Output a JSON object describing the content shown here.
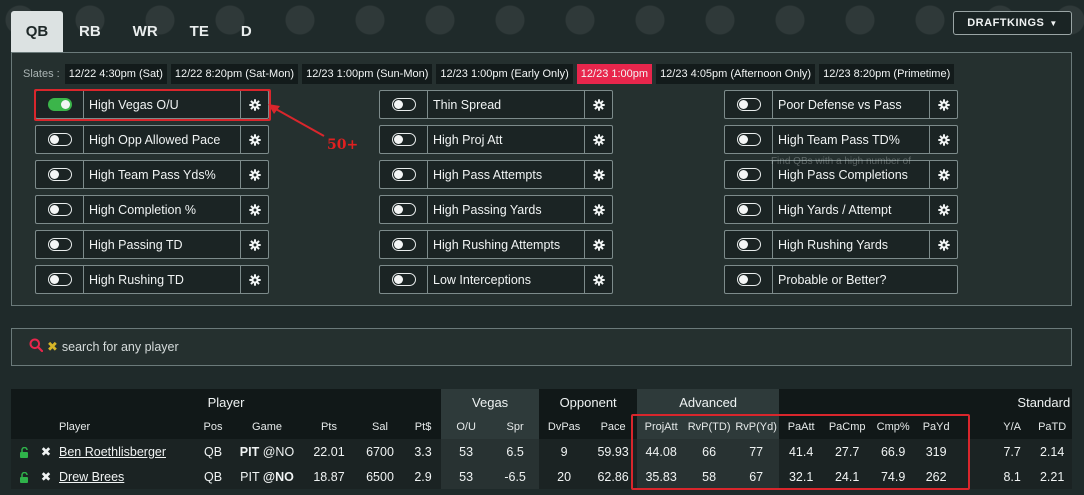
{
  "tabs": [
    "QB",
    "RB",
    "WR",
    "TE",
    "D"
  ],
  "site_button": "DRAFTKINGS",
  "slates_label": "Slates :",
  "slates": [
    {
      "label": "12/22 4:30pm (Sat)",
      "active": false
    },
    {
      "label": "12/22 8:20pm (Sat-Mon)",
      "active": false
    },
    {
      "label": "12/23 1:00pm (Sun-Mon)",
      "active": false
    },
    {
      "label": "12/23 1:00pm (Early Only)",
      "active": false
    },
    {
      "label": "12/23 1:00pm",
      "active": true
    },
    {
      "label": "12/23 4:05pm (Afternoon Only)",
      "active": false
    },
    {
      "label": "12/23 8:20pm (Primetime)",
      "active": false
    }
  ],
  "filters": {
    "col1": [
      {
        "label": "High Vegas O/U",
        "on": true,
        "gear": true
      },
      {
        "label": "High Opp Allowed Pace",
        "on": false,
        "gear": true
      },
      {
        "label": "High Team Pass Yds%",
        "on": false,
        "gear": true
      },
      {
        "label": "High Completion %",
        "on": false,
        "gear": true
      },
      {
        "label": "High Passing TD",
        "on": false,
        "gear": true
      },
      {
        "label": "High Rushing TD",
        "on": false,
        "gear": true
      }
    ],
    "col2": [
      {
        "label": "Thin Spread",
        "on": false,
        "gear": true
      },
      {
        "label": "High Proj Att",
        "on": false,
        "gear": true
      },
      {
        "label": "High Pass Attempts",
        "on": false,
        "gear": true
      },
      {
        "label": "High Passing Yards",
        "on": false,
        "gear": true
      },
      {
        "label": "High Rushing Attempts",
        "on": false,
        "gear": true
      },
      {
        "label": "Low Interceptions",
        "on": false,
        "gear": true
      }
    ],
    "col3": [
      {
        "label": "Poor Defense vs Pass",
        "on": false,
        "gear": true
      },
      {
        "label": "High Team Pass TD%",
        "on": false,
        "gear": true
      },
      {
        "label": "High Pass Completions",
        "on": false,
        "gear": true
      },
      {
        "label": "High Yards / Attempt",
        "on": false,
        "gear": true
      },
      {
        "label": "High Rushing Yards",
        "on": false,
        "gear": true
      },
      {
        "label": "Probable or Better?",
        "on": false,
        "gear": false
      }
    ]
  },
  "tooltip_ghost": "Find QBs with a high number of",
  "annotation": "50+",
  "search": {
    "placeholder": "search for any player"
  },
  "table": {
    "groups": {
      "player": "Player",
      "vegas": "Vegas",
      "opponent": "Opponent",
      "advanced": "Advanced",
      "standard": "Standard"
    },
    "columns": [
      "Player",
      "Pos",
      "Game",
      "Pts",
      "Sal",
      "Pt$",
      "O/U",
      "Spr",
      "DvPas",
      "Pace",
      "ProjAtt",
      "RvP(TD)",
      "RvP(Yd)",
      "PaAtt",
      "PaCmp",
      "Cmp%",
      "PaYd",
      "Y/A",
      "PaTD"
    ],
    "rows": [
      {
        "player": "Ben Roethlisberger",
        "pos": "QB",
        "game_team": "PIT",
        "game_opp": "@NO",
        "team_bold": true,
        "pts": "22.01",
        "sal": "6700",
        "ptd": "3.3",
        "ou": "53",
        "spr": "6.5",
        "dvpas": "9",
        "pace": "59.93",
        "projatt": "44.08",
        "rvptd": "66",
        "rvpyd": "77",
        "paatt": "41.4",
        "pacmp": "27.7",
        "cmp": "66.9",
        "payd": "319",
        "ya": "7.7",
        "patd": "2.14"
      },
      {
        "player": "Drew Brees",
        "pos": "QB",
        "game_team": "PIT",
        "game_opp": "@NO",
        "team_bold": false,
        "pts": "18.87",
        "sal": "6500",
        "ptd": "2.9",
        "ou": "53",
        "spr": "-6.5",
        "dvpas": "20",
        "pace": "62.86",
        "projatt": "35.83",
        "rvptd": "58",
        "rvpyd": "67",
        "paatt": "32.1",
        "pacmp": "24.1",
        "cmp": "74.9",
        "payd": "262",
        "ya": "8.1",
        "patd": "2.21"
      }
    ]
  }
}
